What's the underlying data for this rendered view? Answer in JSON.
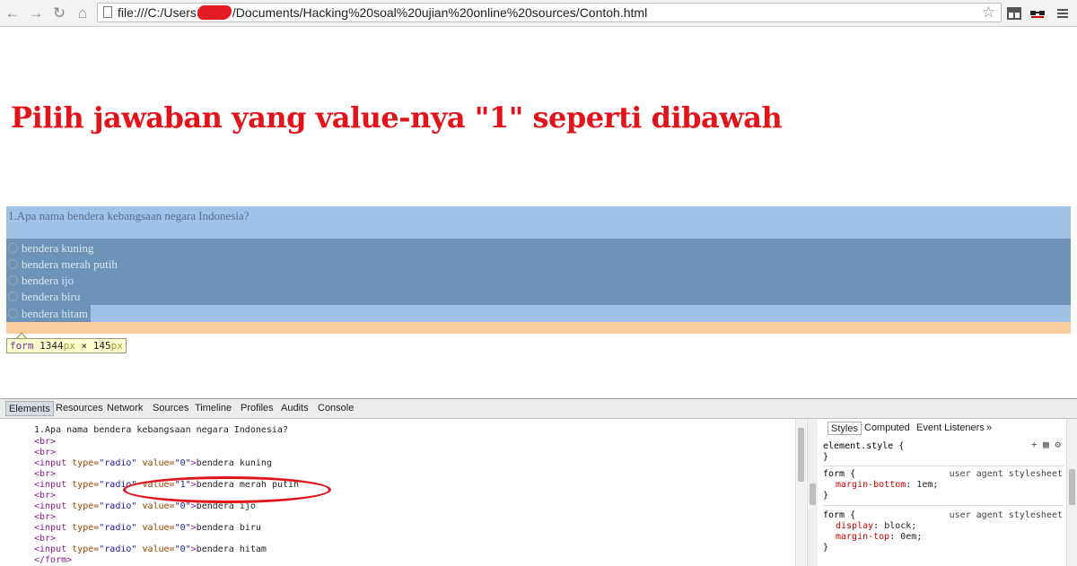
{
  "browser": {
    "url_prefix": "file:///C:/Users",
    "url_suffix": "/Documents/Hacking%20soal%20ujian%20online%20sources/Contoh.html"
  },
  "page": {
    "heading": "Pilih jawaban yang value-nya \"1\" seperti dibawah",
    "question": "1.Apa nama bendera kebangsaan negara Indonesia?",
    "options": [
      "bendera kuning",
      "bendera merah putih",
      "bendera ijo",
      "bendera biru",
      "bendera hitam"
    ],
    "tooltip": {
      "name": "form",
      "width": "1344",
      "height": "145",
      "unit": "px",
      "sep": "×"
    }
  },
  "devtools": {
    "tabs": [
      "Elements",
      "Resources",
      "Network",
      "Sources",
      "Timeline",
      "Profiles",
      "Audits",
      "Console"
    ],
    "active_tab": "Elements",
    "code": {
      "question_text": "1.Apa nama bendera kebangsaan negara Indonesia?",
      "br": "<br>",
      "form_close": "</form>",
      "input_open": "<input",
      "type_attr": "type=",
      "type_val": "\"radio\"",
      "value_attr": "value=",
      "inputs": [
        {
          "value": "\"0\"",
          "label": "bendera kuning"
        },
        {
          "value": "\"1\"",
          "label": "bendera merah putih"
        },
        {
          "value": "\"0\"",
          "label": "bendera ijo"
        },
        {
          "value": "\"0\"",
          "label": "bendera biru"
        },
        {
          "value": "\"0\"",
          "label": "bendera hitam"
        }
      ]
    },
    "styles": {
      "tabs": [
        "Styles",
        "Computed",
        "Event Listeners",
        "»"
      ],
      "element_style": "element.style {",
      "close_brace": "}",
      "rule1": {
        "selector": "form {",
        "origin": "user agent stylesheet",
        "prop": "margin-bottom",
        "value": "1em;"
      },
      "rule2": {
        "selector": "form {",
        "origin": "user agent stylesheet",
        "props": [
          {
            "prop": "display",
            "value": "block;"
          },
          {
            "prop": "margin-top",
            "value": "0em;"
          }
        ]
      }
    }
  }
}
